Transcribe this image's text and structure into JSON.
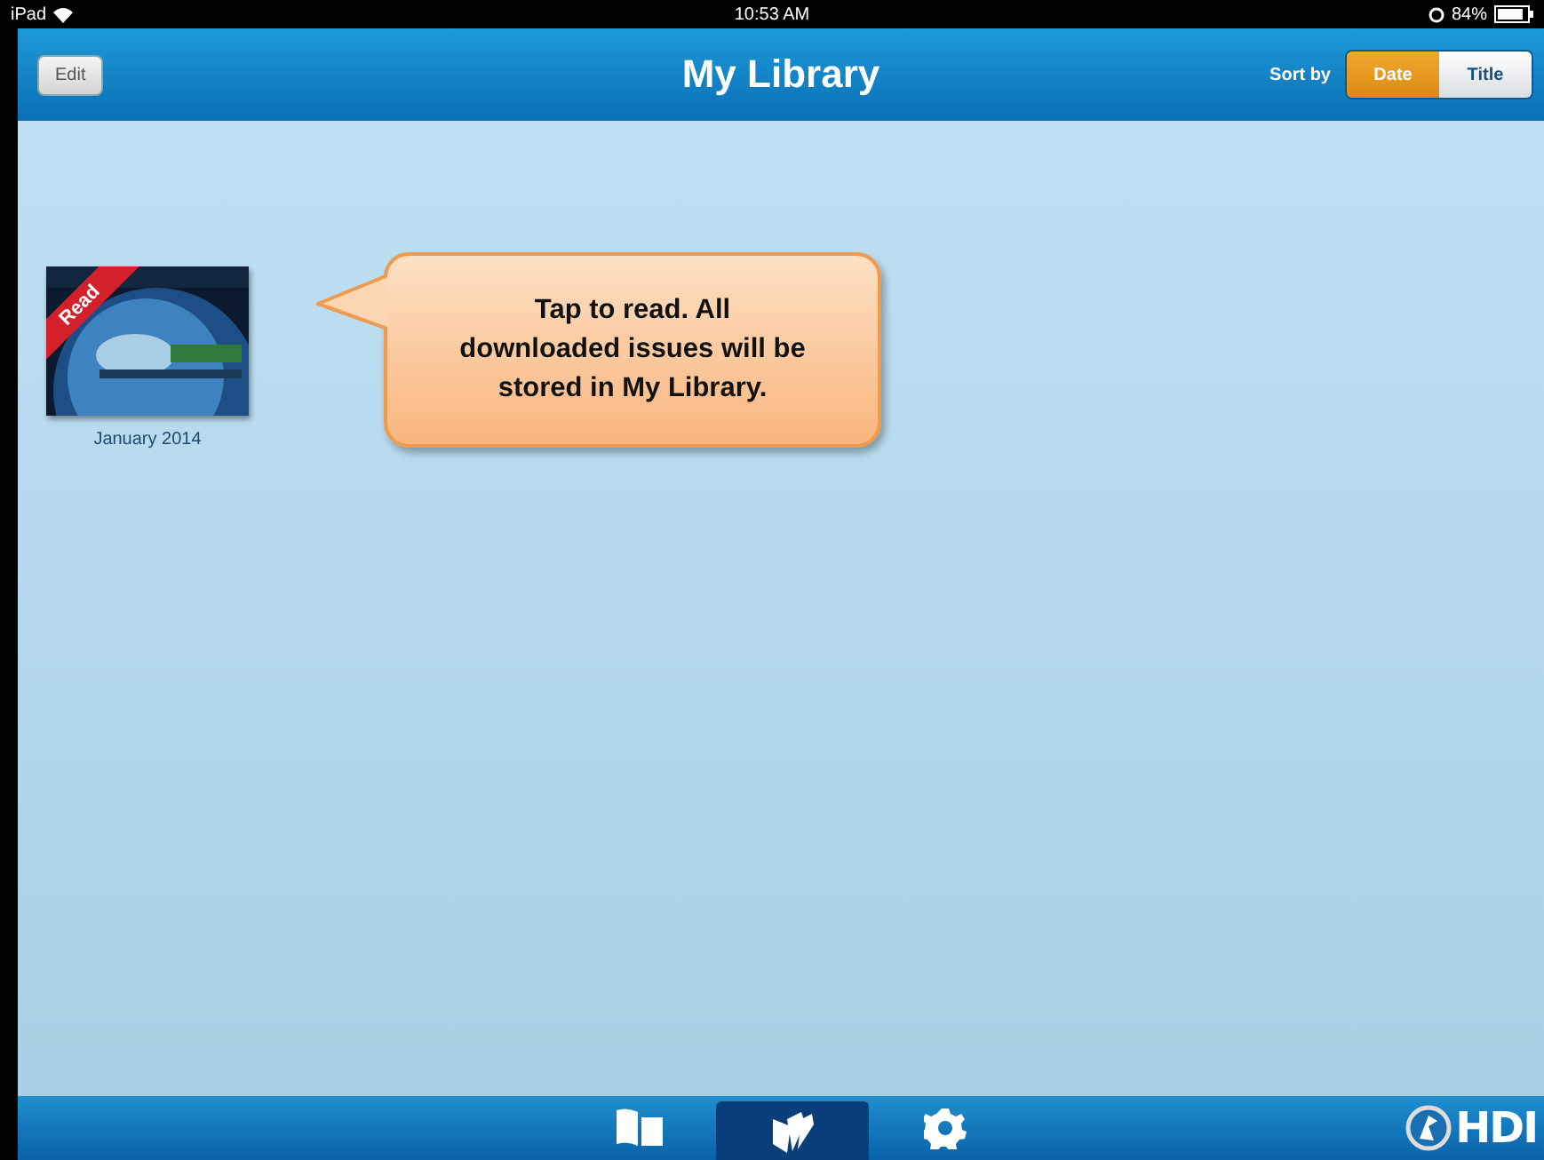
{
  "status_bar": {
    "device": "iPad",
    "time": "10:53 AM",
    "battery": "84%"
  },
  "nav_bar": {
    "edit_button": "Edit",
    "title": "My Library",
    "sort_label": "Sort by",
    "sort_options": [
      {
        "label": "Date",
        "selected": true
      },
      {
        "label": "Title",
        "selected": false
      }
    ]
  },
  "issues": [
    {
      "kind": "picture",
      "ribbon": "Read",
      "caption": "January 2014"
    }
  ],
  "callout": {
    "text": "Tap to read. All downloaded issues will be stored in My Library."
  },
  "tab_bar": {
    "tabs": [
      {
        "kind": "book",
        "selected": false
      },
      {
        "kind": "library",
        "selected": true
      },
      {
        "kind": "settings",
        "selected": false
      }
    ],
    "logo": "HDI"
  }
}
